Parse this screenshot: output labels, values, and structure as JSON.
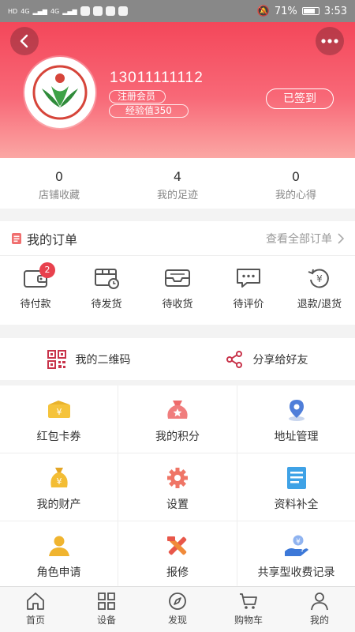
{
  "status_bar": {
    "left_labels": [
      "HD",
      "4G",
      "4G"
    ],
    "battery": "71%",
    "time": "3:53"
  },
  "profile": {
    "phone": "13011111112",
    "member_tag": "注册会员",
    "exp_tag": "经验值350",
    "sign_status": "已签到"
  },
  "stats": [
    {
      "value": "0",
      "label": "店铺收藏"
    },
    {
      "value": "4",
      "label": "我的足迹"
    },
    {
      "value": "0",
      "label": "我的心得"
    }
  ],
  "orders": {
    "title": "我的订单",
    "view_all": "查看全部订单",
    "items": [
      {
        "label": "待付款",
        "icon": "wallet-icon",
        "badge": "2"
      },
      {
        "label": "待发货",
        "icon": "package-clock-icon"
      },
      {
        "label": "待收货",
        "icon": "inbox-icon"
      },
      {
        "label": "待评价",
        "icon": "comment-icon"
      },
      {
        "label": "退款/退货",
        "icon": "refund-icon"
      }
    ]
  },
  "qr": {
    "qr_label": "我的二维码",
    "share_label": "分享给好友"
  },
  "menu": [
    {
      "label": "红包卡券",
      "icon": "coupon-icon"
    },
    {
      "label": "我的积分",
      "icon": "points-bag-icon"
    },
    {
      "label": "地址管理",
      "icon": "location-icon"
    },
    {
      "label": "我的财产",
      "icon": "money-bag-icon"
    },
    {
      "label": "设置",
      "icon": "gear-icon"
    },
    {
      "label": "资料补全",
      "icon": "document-icon"
    },
    {
      "label": "角色申请",
      "icon": "person-icon"
    },
    {
      "label": "报修",
      "icon": "repair-tools-icon"
    },
    {
      "label": "共享型收费记录",
      "icon": "hand-coin-icon"
    }
  ],
  "tabs": [
    {
      "label": "首页",
      "icon": "home-icon"
    },
    {
      "label": "设备",
      "icon": "devices-grid-icon"
    },
    {
      "label": "发现",
      "icon": "compass-icon"
    },
    {
      "label": "购物车",
      "icon": "cart-icon"
    },
    {
      "label": "我的",
      "icon": "user-icon"
    }
  ],
  "colors": {
    "header_top": "#f4475a",
    "header_bottom": "#fba7a4",
    "accent_red": "#e8414d",
    "icon_gray": "#555555"
  }
}
